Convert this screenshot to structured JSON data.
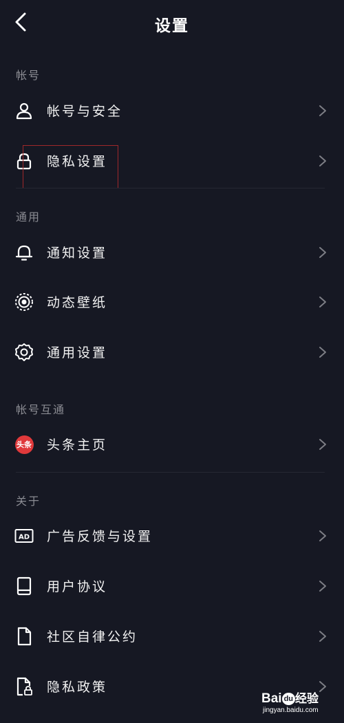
{
  "header": {
    "title": "设置"
  },
  "sections": {
    "account": {
      "title": "帐号",
      "items": [
        {
          "label": "帐号与安全",
          "icon": "person-icon"
        },
        {
          "label": "隐私设置",
          "icon": "lock-icon"
        }
      ]
    },
    "general": {
      "title": "通用",
      "items": [
        {
          "label": "通知设置",
          "icon": "bell-icon"
        },
        {
          "label": "动态壁纸",
          "icon": "live-wallpaper-icon"
        },
        {
          "label": "通用设置",
          "icon": "gear-icon"
        }
      ]
    },
    "linked": {
      "title": "帐号互通",
      "items": [
        {
          "label": "头条主页",
          "icon": "toutiao-icon",
          "badge": "头条"
        }
      ]
    },
    "about": {
      "title": "关于",
      "items": [
        {
          "label": "广告反馈与设置",
          "icon": "ad-icon",
          "icon_text": "AD"
        },
        {
          "label": "用户协议",
          "icon": "book-icon"
        },
        {
          "label": "社区自律公约",
          "icon": "document-icon"
        },
        {
          "label": "隐私政策",
          "icon": "privacy-document-icon"
        }
      ]
    }
  },
  "watermark": {
    "brand_prefix": "Bai",
    "brand_du": "du",
    "brand_suffix": "经验",
    "url": "jingyan.baidu.com"
  },
  "colors": {
    "background": "#161823",
    "text": "#f2f2f2",
    "section_title": "#8b8c93",
    "divider": "#262833",
    "highlight": "#a0282a",
    "toutiao_red": "#e0393b"
  }
}
